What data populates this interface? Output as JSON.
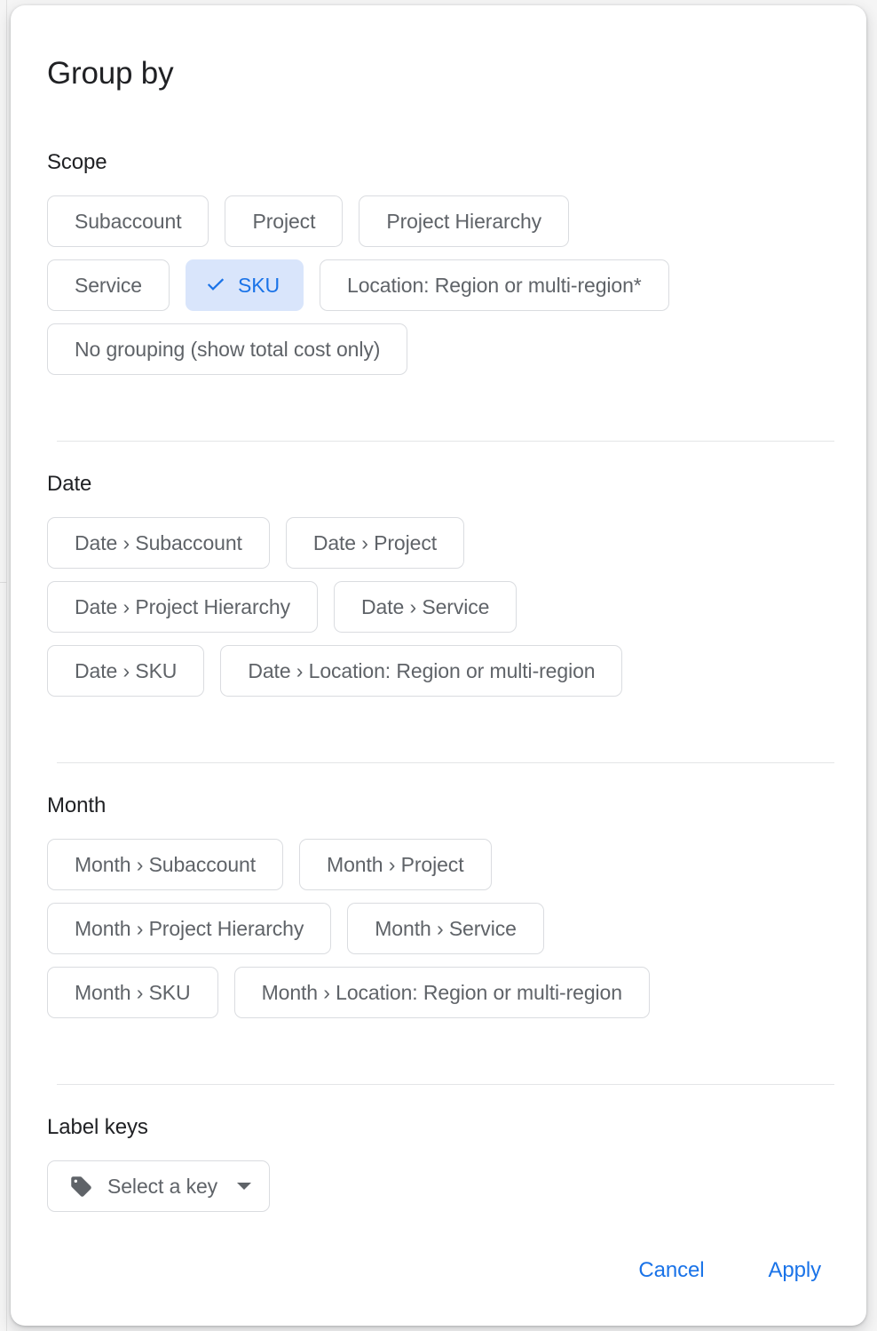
{
  "dialog": {
    "title": "Group by"
  },
  "sections": {
    "scope": {
      "header": "Scope",
      "rows": [
        [
          {
            "label": "Subaccount",
            "selected": false
          },
          {
            "label": "Project",
            "selected": false
          },
          {
            "label": "Project Hierarchy",
            "selected": false
          }
        ],
        [
          {
            "label": "Service",
            "selected": false
          },
          {
            "label": "SKU",
            "selected": true
          },
          {
            "label": "Location: Region or multi-region*",
            "selected": false
          }
        ],
        [
          {
            "label": "No grouping (show total cost only)",
            "selected": false
          }
        ]
      ]
    },
    "date": {
      "header": "Date",
      "rows": [
        [
          {
            "label": "Date › Subaccount",
            "selected": false
          },
          {
            "label": "Date › Project",
            "selected": false
          }
        ],
        [
          {
            "label": "Date › Project Hierarchy",
            "selected": false
          },
          {
            "label": "Date › Service",
            "selected": false
          }
        ],
        [
          {
            "label": "Date › SKU",
            "selected": false
          },
          {
            "label": "Date › Location: Region or multi-region",
            "selected": false
          }
        ]
      ]
    },
    "month": {
      "header": "Month",
      "rows": [
        [
          {
            "label": "Month › Subaccount",
            "selected": false
          },
          {
            "label": "Month › Project",
            "selected": false
          }
        ],
        [
          {
            "label": "Month › Project Hierarchy",
            "selected": false
          },
          {
            "label": "Month › Service",
            "selected": false
          }
        ],
        [
          {
            "label": "Month › SKU",
            "selected": false
          },
          {
            "label": "Month › Location: Region or multi-region",
            "selected": false
          }
        ]
      ]
    },
    "label_keys": {
      "header": "Label keys",
      "select": {
        "icon": "tag-icon",
        "text": "Select a key",
        "caret": "chevron-down-icon"
      }
    }
  },
  "footer": {
    "cancel_label": "Cancel",
    "apply_label": "Apply"
  },
  "colors": {
    "accent": "#1a73e8",
    "selected_chip_bg": "#d9e5fb",
    "chip_border": "#dadce0",
    "text_primary": "#202124",
    "text_secondary": "#5f6368",
    "divider": "#e4e5e7"
  },
  "icons": {
    "check": "check-icon"
  }
}
